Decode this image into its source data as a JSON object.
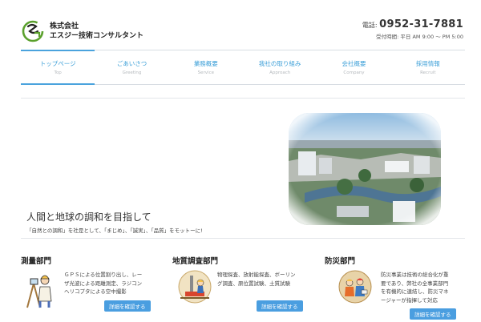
{
  "header": {
    "company_line1": "株式会社",
    "company_line2": "エスジー技術コンサルタント",
    "phone_label": "電話:",
    "phone_number": "0952-31-7881",
    "hours": "受付時間: 平日 AM 9:00 〜 PM 5:00"
  },
  "nav": {
    "items": [
      {
        "jp": "トップページ",
        "en": "Top"
      },
      {
        "jp": "ごあいさつ",
        "en": "Greeting"
      },
      {
        "jp": "業務概要",
        "en": "Service"
      },
      {
        "jp": "我社の取り組み",
        "en": "Approach"
      },
      {
        "jp": "会社概要",
        "en": "Company"
      },
      {
        "jp": "採用情報",
        "en": "Recruit"
      }
    ]
  },
  "hero": {
    "title": "人間と地球の調和を目指して",
    "subtitle": "「自然との調和」を社是として、「まじめ」、「誠実」、「品質」をモットーに!"
  },
  "departments": [
    {
      "title": "測量部門",
      "lines": [
        "ＧＰＳによる位置割り出し、レー",
        "ザ光波による距離測定、ラジコン",
        "ヘリコプタによる空中撮影"
      ],
      "button": "詳細を確認する"
    },
    {
      "title": "地質調査部門",
      "lines": [
        "物理探査、放射能探査、ボーリン",
        "グ調査、原位置試験、土質試験"
      ],
      "button": "詳細を確認する"
    },
    {
      "title": "防災部門",
      "lines": [
        "防災事業は技術の総合化が重",
        "要であり、弊社の全事業部門",
        "を有機的に連結し、防災マネ",
        "ージャーが指揮して対応"
      ],
      "button": "詳細を確認する"
    }
  ],
  "colors": {
    "accent": "#4a9ee0",
    "nav_text": "#3ea0d8",
    "logo_green": "#5aa02c"
  }
}
